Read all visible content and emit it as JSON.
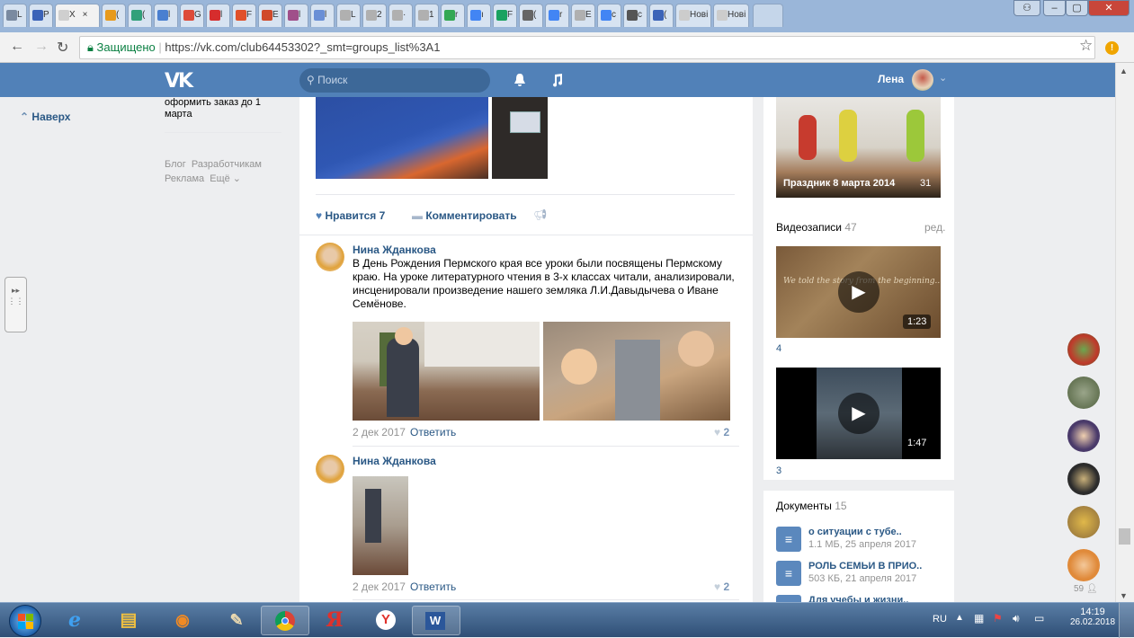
{
  "browser": {
    "tabs": [
      {
        "label": "L",
        "color": "#7a8aa0"
      },
      {
        "label": "P",
        "color": "#3b63b8"
      },
      {
        "label": "Х",
        "color": "#cfcfcf"
      },
      {
        "label": "(",
        "color": "#e79a1d"
      },
      {
        "label": "(",
        "color": "#31a07a"
      },
      {
        "label": "l",
        "color": "#4a7fd0"
      },
      {
        "label": "G",
        "color": "#dd4b39"
      },
      {
        "label": "l",
        "color": "#d62d2d"
      },
      {
        "label": "F",
        "color": "#e0502a"
      },
      {
        "label": "E",
        "color": "#d04a2a"
      },
      {
        "label": "l",
        "color": "#a04f8a"
      },
      {
        "label": "l",
        "color": "#6a8fd6"
      },
      {
        "label": "L",
        "color": "#b0b0b0"
      },
      {
        "label": "2",
        "color": "#b0b0b0"
      },
      {
        "label": "·",
        "color": "#b0b0b0"
      },
      {
        "label": "1",
        "color": "#b0b0b0"
      },
      {
        "label": "r",
        "color": "#34a853"
      },
      {
        "label": "ı",
        "color": "#4285f4"
      },
      {
        "label": "F",
        "color": "#1aa260"
      },
      {
        "label": "(",
        "color": "#666666"
      },
      {
        "label": "r",
        "color": "#4285f4"
      },
      {
        "label": "E",
        "color": "#b0b0b0"
      },
      {
        "label": "c",
        "color": "#4285f4"
      },
      {
        "label": "c",
        "color": "#555555"
      },
      {
        "label": "(",
        "color": "#3b63b8"
      },
      {
        "label": "Нові",
        "color": "#cccccc"
      },
      {
        "label": "Нові",
        "color": "#cccccc"
      }
    ],
    "active_close": "×",
    "window_buttons": [
      "⚇",
      "–",
      "▢",
      "✕"
    ],
    "secure_label": "Защищено",
    "url": "https://vk.com/club64453302?_smt=groups_list%3A1"
  },
  "vk": {
    "search_placeholder": "Поиск",
    "user_name": "Лена",
    "up_label": "Наверх",
    "left_text": "оформить заказ до 1 марта",
    "footer_links": [
      "Блог",
      "Разработчикам",
      "Реклама",
      "Ещё ⌄"
    ]
  },
  "post1": {
    "likes_label": "Нравится",
    "likes": "7",
    "comment_label": "Комментировать"
  },
  "comments": [
    {
      "author": "Нина Жданкова",
      "text": "В День Рождения Пермского края все уроки были посвящены Пермскому краю. На уроке литературного чтения в 3-х классах читали, анализировали, инсценировали произведение нашего земляка Л.И.Давыдычева о Иване Семёнове.",
      "date": "2 дек 2017",
      "reply": "Ответить",
      "likes": "2"
    },
    {
      "author": "Нина Жданкова",
      "text": "",
      "date": "2 дек 2017",
      "reply": "Ответить",
      "likes": "2"
    }
  ],
  "sidebar": {
    "album_title": "Праздник 8 марта 2014",
    "album_count": "31",
    "videos_label": "Видеозаписи",
    "videos_count": "47",
    "edit_label": "ред.",
    "videos": [
      {
        "duration": "1:23",
        "overlay": "We told the story from the beginning...",
        "views": "4"
      },
      {
        "duration": "1:47",
        "overlay": "",
        "views": "3"
      }
    ],
    "docs_label": "Документы",
    "docs_count": "15",
    "docs": [
      {
        "title": "о ситуации с тубе..",
        "meta": "1.1 МБ, 25 апреля 2017"
      },
      {
        "title": "РОЛЬ СЕМЬИ В ПРИО..",
        "meta": "503 КБ, 21 апреля 2017"
      },
      {
        "title": "Для учебы и жизни..",
        "meta": ""
      }
    ]
  },
  "friends_count": "59",
  "taskbar": {
    "lang": "RU",
    "time": "14:19",
    "date": "26.02.2018",
    "apps": [
      "start",
      "ie",
      "explorer",
      "media",
      "paint",
      "chrome",
      "yandex-browser",
      "yandex",
      "word"
    ]
  }
}
